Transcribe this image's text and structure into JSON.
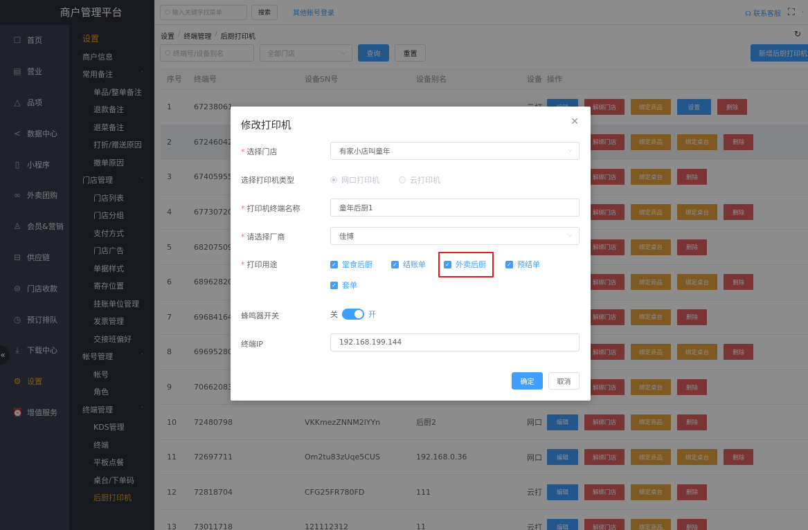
{
  "app": {
    "brand": "商户管理平台"
  },
  "topbar": {
    "search_placeholder": "输入关键字找菜单",
    "search_button": "搜索",
    "other_login": "其他账号登录",
    "contact": "联系客服",
    "more": "·"
  },
  "left_nav": [
    {
      "label": "首页",
      "icon": "home-icon",
      "glyph": "☐"
    },
    {
      "label": "营业",
      "icon": "calendar-icon",
      "glyph": "▤"
    },
    {
      "label": "品项",
      "icon": "bag-icon",
      "glyph": "△"
    },
    {
      "label": "数据中心",
      "icon": "share-icon",
      "glyph": "<"
    },
    {
      "label": "小程序",
      "icon": "phone-icon",
      "glyph": "▯"
    },
    {
      "label": "外卖团购",
      "icon": "group-icon",
      "glyph": "∞"
    },
    {
      "label": "会员&营销",
      "icon": "user-icon",
      "glyph": "♙"
    },
    {
      "label": "供应链",
      "icon": "truck-icon",
      "glyph": "⊟"
    },
    {
      "label": "门店收款",
      "icon": "database-icon",
      "glyph": "⊜"
    },
    {
      "label": "预订排队",
      "icon": "clock-icon",
      "glyph": "◷"
    },
    {
      "label": "下载中心",
      "icon": "download-icon",
      "glyph": "⤓"
    },
    {
      "label": "设置",
      "icon": "gear-icon",
      "glyph": "⚙"
    },
    {
      "label": "增值服务",
      "icon": "alarm-icon",
      "glyph": "⏰"
    }
  ],
  "nav_collapse": "«",
  "sub_nav": {
    "title": "设置",
    "rows": [
      {
        "label": "商户信息",
        "type": "top"
      },
      {
        "label": "常用备注",
        "type": "grp"
      },
      {
        "label": "单品/整单备注",
        "type": "child"
      },
      {
        "label": "退款备注",
        "type": "child"
      },
      {
        "label": "退菜备注",
        "type": "child"
      },
      {
        "label": "打折/赠送原因",
        "type": "child"
      },
      {
        "label": "撤单原因",
        "type": "child"
      },
      {
        "label": "门店管理",
        "type": "grp"
      },
      {
        "label": "门店列表",
        "type": "child"
      },
      {
        "label": "门店分组",
        "type": "child"
      },
      {
        "label": "支付方式",
        "type": "child"
      },
      {
        "label": "门店广告",
        "type": "child"
      },
      {
        "label": "单据样式",
        "type": "child"
      },
      {
        "label": "寄存位置",
        "type": "child"
      },
      {
        "label": "挂账单位管理",
        "type": "child"
      },
      {
        "label": "发票管理",
        "type": "child"
      },
      {
        "label": "交接班偏好",
        "type": "child"
      },
      {
        "label": "帐号管理",
        "type": "grp"
      },
      {
        "label": "帐号",
        "type": "child"
      },
      {
        "label": "角色",
        "type": "child"
      },
      {
        "label": "终端管理",
        "type": "grp"
      },
      {
        "label": "KDS管理",
        "type": "child"
      },
      {
        "label": "终端",
        "type": "child"
      },
      {
        "label": "平板点餐",
        "type": "child"
      },
      {
        "label": "桌台/下单码",
        "type": "child"
      },
      {
        "label": "后厨打印机",
        "type": "child",
        "active": true
      }
    ]
  },
  "breadcrumb": [
    "设置",
    "终端管理",
    "后厨打印机"
  ],
  "filters": {
    "terminal_placeholder": "终端号/设备别名",
    "store_placeholder": "全部门店",
    "query": "查询",
    "reset": "重置",
    "add": "新增后厨打印机"
  },
  "table": {
    "headers": [
      "序号",
      "终端号",
      "设备SN号",
      "设备别名",
      "设备",
      "操作"
    ],
    "rows": [
      {
        "no": "1",
        "term": "67238061",
        "sn": "",
        "alias": "",
        "type": "云打",
        "ops": [
          "edit",
          "unbind",
          "goods",
          "set",
          "del"
        ]
      },
      {
        "no": "2",
        "term": "67246042",
        "sn": "",
        "alias": "",
        "type": "",
        "ops": [
          "edit",
          "unbind",
          "goods",
          "table",
          "del"
        ],
        "hl": true
      },
      {
        "no": "3",
        "term": "67405955",
        "sn": "",
        "alias": "",
        "type": "",
        "ops": [
          "edit",
          "unbind",
          "table",
          "del"
        ]
      },
      {
        "no": "4",
        "term": "67730720",
        "sn": "",
        "alias": "",
        "type": "",
        "ops": [
          "edit",
          "unbind",
          "goods",
          "table",
          "del"
        ]
      },
      {
        "no": "5",
        "term": "68207509",
        "sn": "",
        "alias": "",
        "type": "",
        "ops": [
          "edit",
          "unbind",
          "table",
          "del"
        ]
      },
      {
        "no": "6",
        "term": "68962820",
        "sn": "",
        "alias": "",
        "type": "",
        "ops": [
          "edit",
          "unbind",
          "goods",
          "table",
          "del"
        ]
      },
      {
        "no": "7",
        "term": "69684164",
        "sn": "",
        "alias": "",
        "type": "",
        "ops": [
          "edit",
          "unbind",
          "table",
          "del"
        ]
      },
      {
        "no": "8",
        "term": "69695280",
        "sn": "",
        "alias": "",
        "type": "",
        "ops": [
          "edit",
          "unbind",
          "goods",
          "table",
          "del"
        ]
      },
      {
        "no": "9",
        "term": "70662083",
        "sn": "",
        "alias": "",
        "type": "",
        "ops": [
          "edit",
          "unbind",
          "table",
          "del"
        ]
      },
      {
        "no": "10",
        "term": "72480798",
        "sn": "VKKmezZNNM2lYYn",
        "alias": "后厨2",
        "type": "网口",
        "ops": [
          "edit",
          "unbind",
          "goods",
          "del"
        ]
      },
      {
        "no": "11",
        "term": "72697711",
        "sn": "Om2tu83zUqe5CUS",
        "alias": "192.168.0.36",
        "type": "网口",
        "ops": [
          "edit",
          "unbind",
          "goods",
          "table",
          "del"
        ]
      },
      {
        "no": "12",
        "term": "72818704",
        "sn": "CFG25FR780FD",
        "alias": "111",
        "type": "云打",
        "ops": [
          "edit",
          "unbind",
          "table",
          "del"
        ]
      },
      {
        "no": "13",
        "term": "73011718",
        "sn": "121112312",
        "alias": "11",
        "type": "云打",
        "ops": [
          "edit",
          "unbind",
          "goods",
          "del"
        ]
      }
    ],
    "op_labels": {
      "edit": "编辑",
      "unbind": "解绑门店",
      "goods": "绑定商品",
      "table": "绑定桌台",
      "set": "设置",
      "del": "删除"
    }
  },
  "modal": {
    "title": "修改打印机",
    "store_label": "选择门店",
    "store_value": "有家小店叫童年",
    "type_label": "选择打印机类型",
    "type_options": [
      "网口打印机",
      "云打印机"
    ],
    "name_label": "打印机终端名称",
    "name_value": "童年后厨1",
    "vendor_label": "请选择厂商",
    "vendor_value": "佳博",
    "usage_label": "打印用途",
    "usage_options": [
      "堂食后厨",
      "结账单",
      "外卖后厨",
      "预结单",
      "套单"
    ],
    "buzzer_label": "蜂鸣器开关",
    "buzzer_off": "关",
    "buzzer_on": "开",
    "buzzer_state": true,
    "ip_label": "终端IP",
    "ip_value": "192.168.199.144",
    "ok": "确定",
    "cancel": "取消"
  },
  "colors": {
    "primary": "#409eff",
    "danger": "#e06060",
    "warning": "#e6a23c",
    "sidebar": "#3a3f4d",
    "subnav": "#2b2f3a",
    "accent": "#f0a020",
    "highlight_box": "#e02020"
  }
}
